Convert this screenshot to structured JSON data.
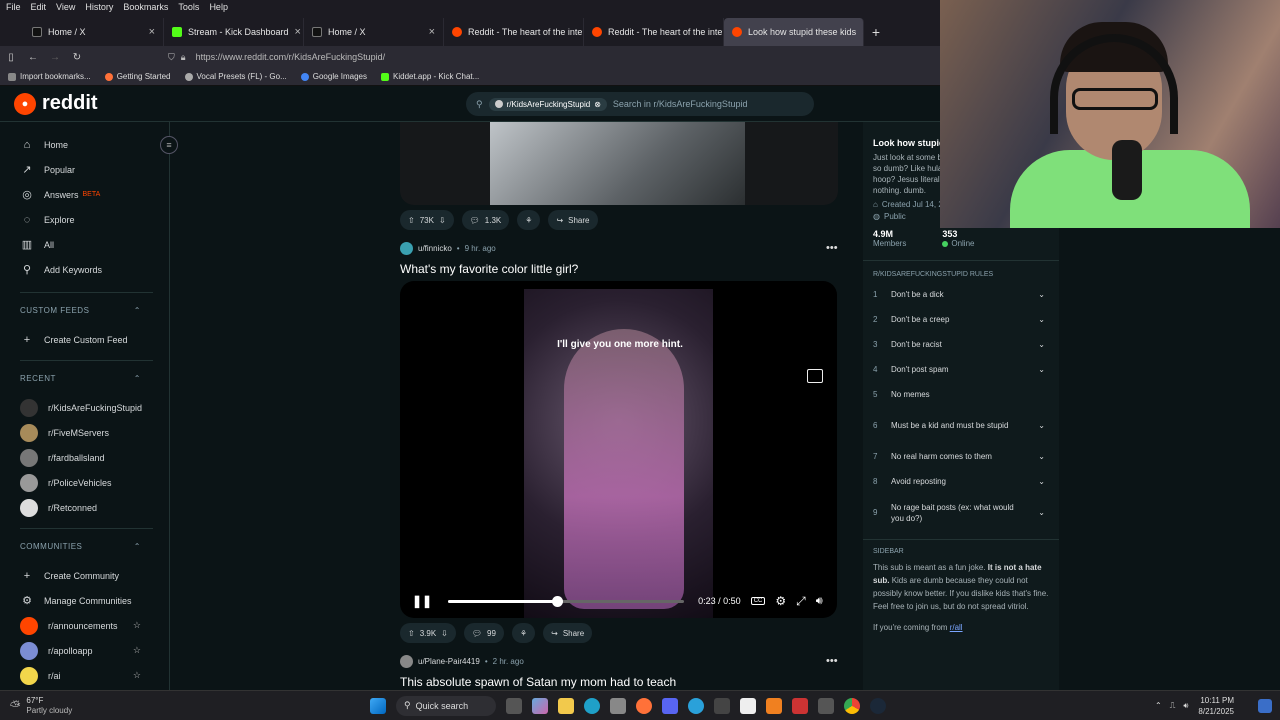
{
  "browser": {
    "menu": [
      "File",
      "Edit",
      "View",
      "History",
      "Bookmarks",
      "Tools",
      "Help"
    ],
    "tabs": [
      {
        "label": "Home / X",
        "color": "#e6e6e6"
      },
      {
        "label": "Stream - Kick Dashboard",
        "color": "#53fc18"
      },
      {
        "label": "Home / X",
        "color": "#e6e6e6"
      },
      {
        "label": "Reddit - The heart of the interne",
        "color": "#ff4500"
      },
      {
        "label": "Reddit - The heart of the interne",
        "color": "#ff4500"
      },
      {
        "label": "Look how stupid these kids",
        "color": "#ff4500",
        "active": true
      }
    ],
    "url": "https://www.reddit.com/r/KidsAreFuckingStupid/",
    "bookmarks": [
      "Import bookmarks...",
      "Getting Started",
      "Vocal Presets (FL) - Go...",
      "Google Images",
      "Kiddet.app - Kick Chat..."
    ]
  },
  "header": {
    "logo": "reddit",
    "search_chip": "r/KidsAreFuckingStupid",
    "search_placeholder": "Search in r/KidsAreFuckingStupid"
  },
  "leftnav": {
    "items": [
      {
        "label": "Home",
        "icon": "home-icon",
        "glyph": "⌂"
      },
      {
        "label": "Popular",
        "icon": "popular-icon",
        "glyph": "↗"
      },
      {
        "label": "Answers",
        "badge": "BETA",
        "icon": "answers-icon",
        "glyph": "◎"
      },
      {
        "label": "Explore",
        "icon": "explore-icon",
        "glyph": "◌"
      },
      {
        "label": "All",
        "icon": "all-icon",
        "glyph": "▥"
      },
      {
        "label": "Add Keywords",
        "icon": "keywords-icon",
        "glyph": "⚲"
      }
    ],
    "custom_feeds_heading": "CUSTOM FEEDS",
    "create_custom_feed": "Create Custom Feed",
    "recent_heading": "RECENT",
    "recent": [
      "r/KidsAreFuckingStupid",
      "r/FiveMServers",
      "r/fardballsland",
      "r/PoliceVehicles",
      "r/Retconned"
    ],
    "communities_heading": "COMMUNITIES",
    "create_community": "Create Community",
    "manage_communities": "Manage Communities",
    "communities": [
      "r/announcements",
      "r/apolloapp",
      "r/ai"
    ]
  },
  "prev_post": {
    "upvotes": "73K",
    "comments": "1.3K",
    "share": "Share"
  },
  "post": {
    "author": "u/finnicko",
    "time": "9 hr. ago",
    "title": "What's my favorite color little girl?",
    "caption": "I'll give you one more hint.",
    "current_time": "0:23",
    "duration": "0:50",
    "progress": 0.46,
    "upvotes": "3.9K",
    "comments": "99",
    "share": "Share"
  },
  "next_post": {
    "author": "u/Plane-Pair4419",
    "time": "2 hr. ago",
    "title": "This absolute spawn of Satan my mom had to teach"
  },
  "sidebar": {
    "title": "Look how stupid",
    "description": "Just look at some be so dumb? Like hula hoop? Jesus literally nothing. dumb.",
    "created": "Created Jul 14, 201",
    "visibility": "Public",
    "members_count": "4.9M",
    "members_label": "Members",
    "online_count": "353",
    "online_label": "Online",
    "rules_heading": "R/KIDSAREFUCKINGSTUPID RULES",
    "rules": [
      "Don't be a dick",
      "Don't be a creep",
      "Don't be racist",
      "Don't post spam",
      "No memes",
      "Must be a kid and must be stupid",
      "No real harm comes to them",
      "Avoid reposting",
      "No rage bait posts (ex: what would you do?)"
    ],
    "sidebar_heading": "SIDEBAR",
    "sidebar_text_1": "This sub is meant as a fun joke.",
    "sidebar_text_bold": "It is not a hate sub.",
    "sidebar_text_2": "Kids are dumb because they could not possibly know better. If you dislike kids that's fine. Feel free to join us, but do not spread vitriol.",
    "coming_from": "If you're coming from",
    "coming_link": "r/all"
  },
  "taskbar": {
    "temp": "67°F",
    "weather": "Partly cloudy",
    "search": "Quick search",
    "time": "10:11 PM",
    "date": "8/21/2025"
  },
  "colors": {
    "accent": "#ff4500",
    "online": "#46d160",
    "bg": "#0b1416"
  }
}
